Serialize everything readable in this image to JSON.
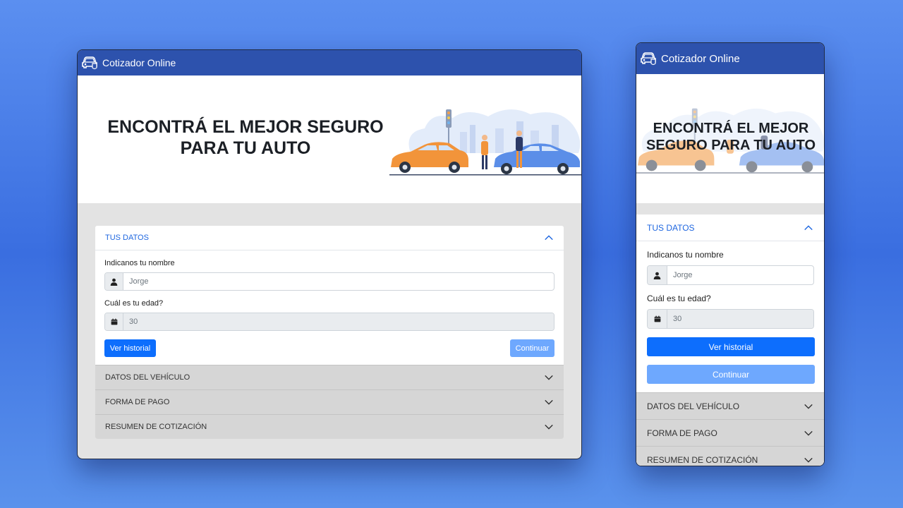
{
  "app": {
    "brand": "Cotizador Online"
  },
  "hero": {
    "title": "ENCONTRÁ EL MEJOR SEGURO PARA TU AUTO"
  },
  "form": {
    "section_active": "TUS DATOS",
    "name_label": "Indicanos tu nombre",
    "name_value": "Jorge",
    "age_label": "Cuál es tu edad?",
    "age_value": "30",
    "history_button": "Ver historial",
    "continue_button": "Continuar"
  },
  "sections": [
    "DATOS DEL VEHÍCULO",
    "FORMA DE PAGO",
    "RESUMEN DE COTIZACIÓN"
  ],
  "colors": {
    "navbar": "#2d52ad",
    "accent": "#1f67e0",
    "primary_button": "#0d6efd",
    "disabled_button": "#6ea8fe"
  },
  "icons": [
    "car-icon",
    "user-icon",
    "calendar-icon",
    "chevron-up-icon",
    "chevron-down-icon"
  ]
}
